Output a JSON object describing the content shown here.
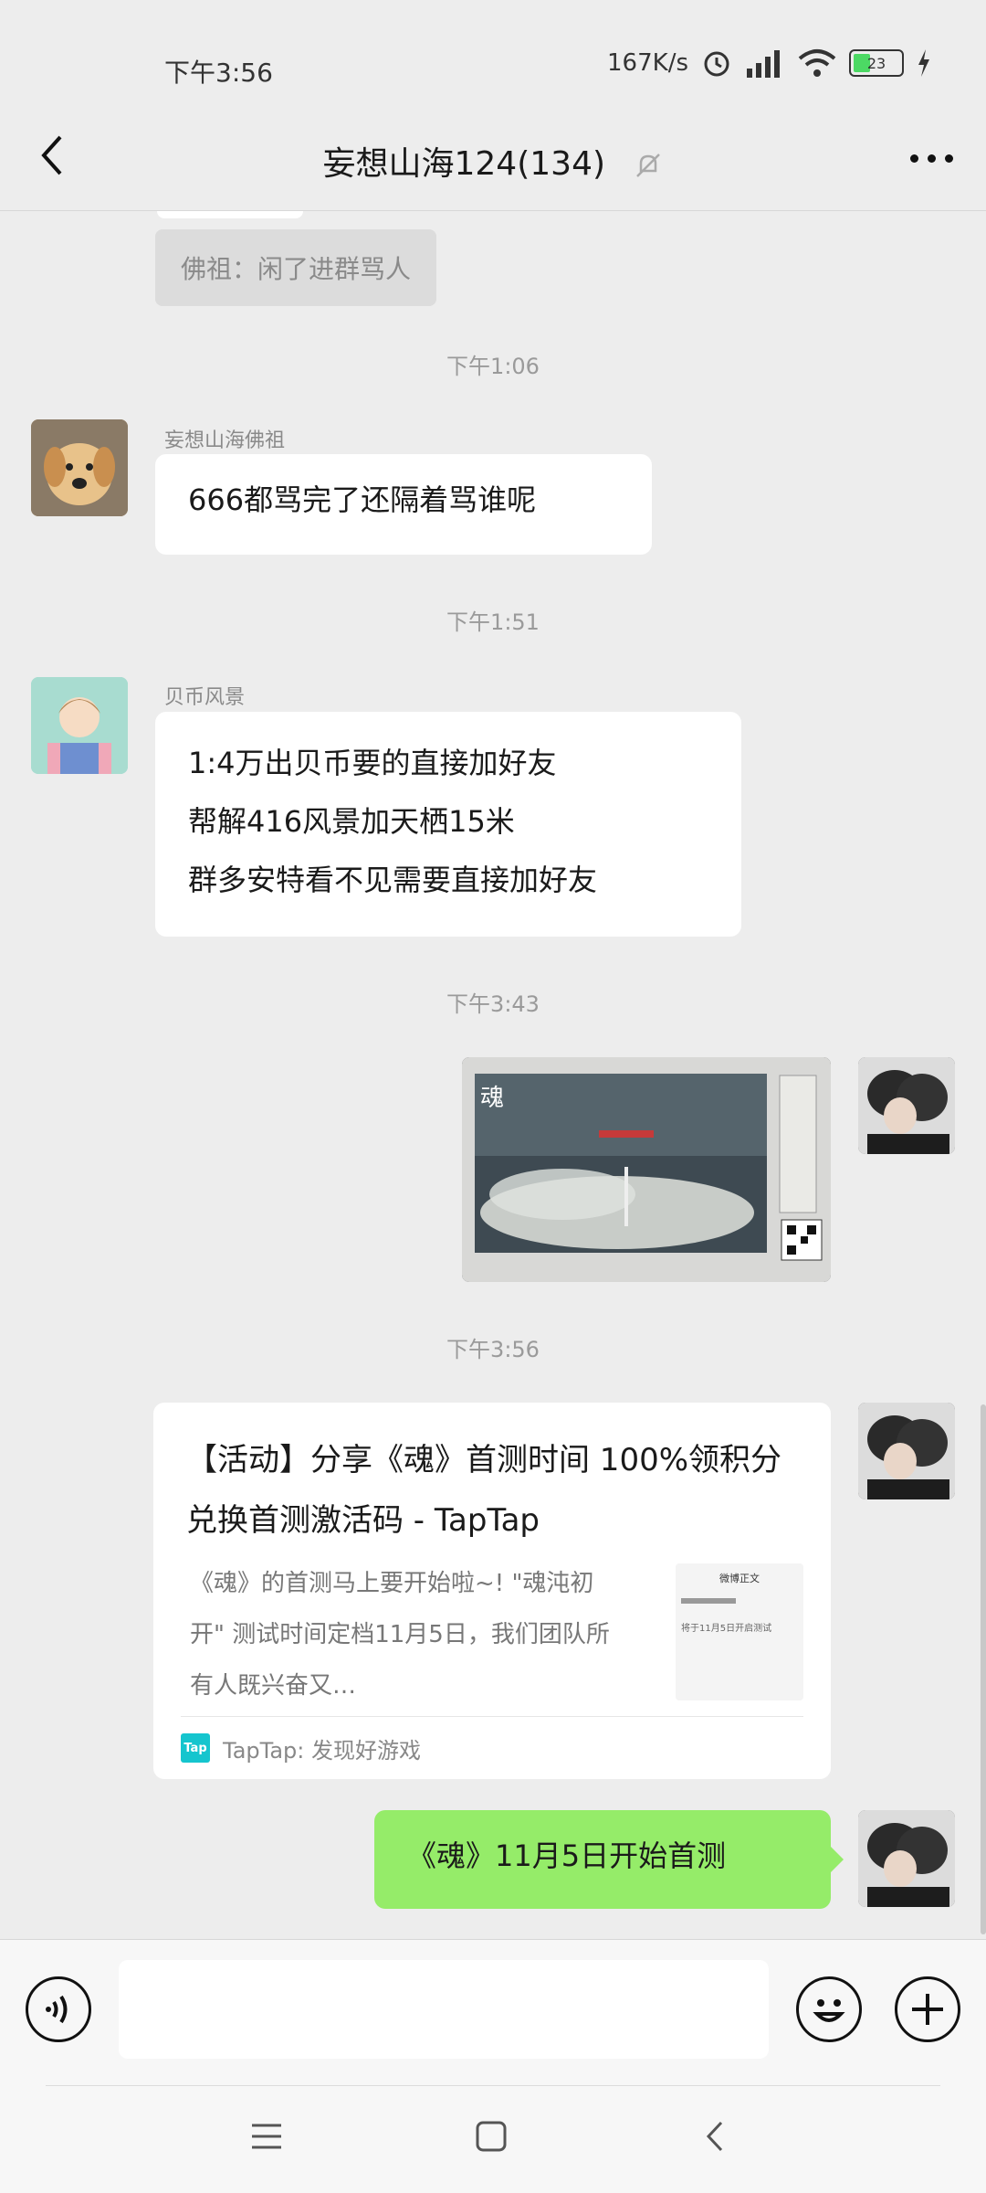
{
  "status": {
    "time": "下午3:56",
    "speed": "167K/s",
    "battery": "23"
  },
  "header": {
    "title": "妄想山海124(134)"
  },
  "messages": {
    "system_text": "佛祖：闲了进群骂人",
    "t1": "下午1:06",
    "m1_sender": "妄想山海佛祖",
    "m1_text": "666都骂完了还隔着骂谁呢",
    "t2": "下午1:51",
    "m2_sender": "贝币风景",
    "m2_line1": "1:4万出贝币要的直接加好友",
    "m2_line2": "帮解416风景加天栖15米",
    "m2_line3": "群多安特看不见需要直接加好友",
    "t3": "下午3:43",
    "image_caption": "魂",
    "t4": "下午3:56",
    "card_title": "【活动】分享《魂》首测时间 100%领积分兑换首测激活码 - TapTap",
    "card_body": "《魂》的首测马上要开始啦~! \"魂沌初开\" 测试时间定档11月5日，我们团队所有人既兴奋又…",
    "card_source": "TapTap: 发现好游戏",
    "tap_logo": "Tap",
    "thumb_header": "微博正文",
    "thumb_text": "将于11月5日开启测试",
    "last_text": "《魂》11月5日开始首测"
  },
  "colors": {
    "bg": "#ededed",
    "bubble_self": "#95ec69",
    "bubble_other": "#ffffff"
  }
}
